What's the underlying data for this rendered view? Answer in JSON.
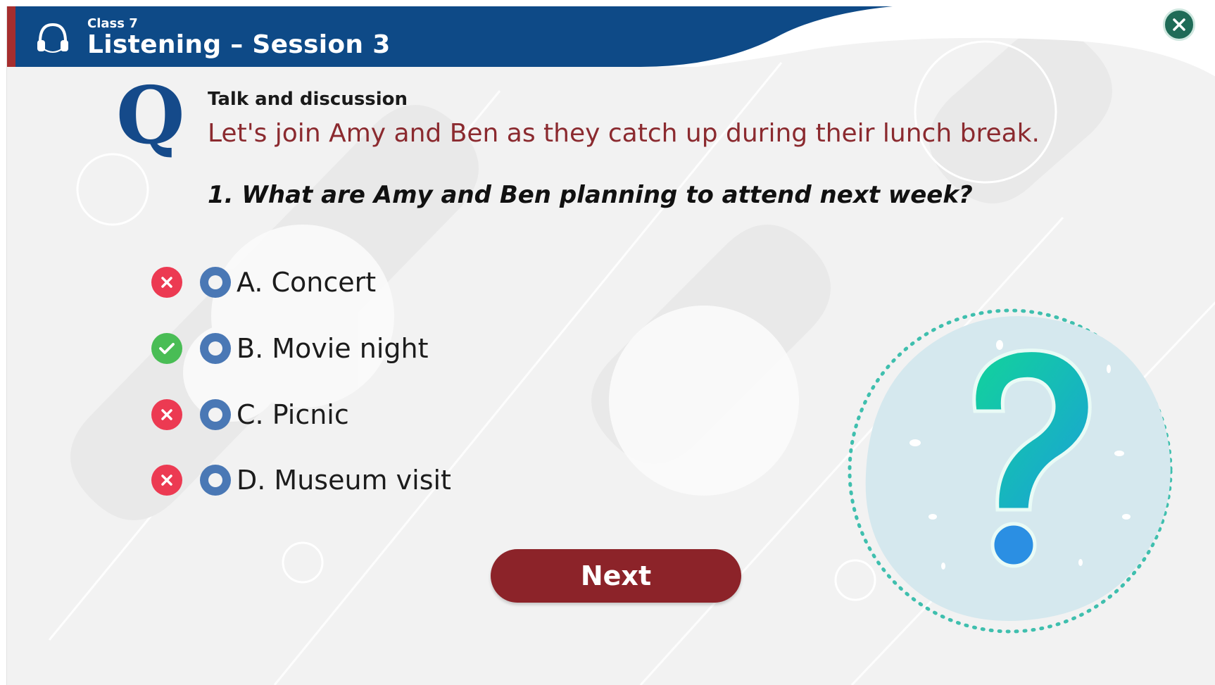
{
  "header": {
    "class_label": "Class 7",
    "title": "Listening – Session 3",
    "icon": "headphones-icon",
    "close_icon": "close-icon"
  },
  "question": {
    "logo_letter": "Q",
    "section": "Talk and discussion",
    "prompt": "Let's join Amy and Ben as they catch up during their lunch break.",
    "text": "1. What are Amy and Ben planning to attend next week?"
  },
  "options": [
    {
      "label": "A. Concert",
      "status": "wrong"
    },
    {
      "label": "B. Movie night",
      "status": "correct"
    },
    {
      "label": "C. Picnic",
      "status": "wrong"
    },
    {
      "label": "D. Museum visit",
      "status": "wrong"
    }
  ],
  "next_label": "Next",
  "colors": {
    "header_blue": "#0e4a87",
    "accent_red": "#8c2329",
    "prompt_red": "#8b2a2f",
    "correct_green": "#49bd55",
    "wrong_red": "#ec3a52",
    "radio_blue": "#4a78b5",
    "close_green": "#1f6b57"
  }
}
